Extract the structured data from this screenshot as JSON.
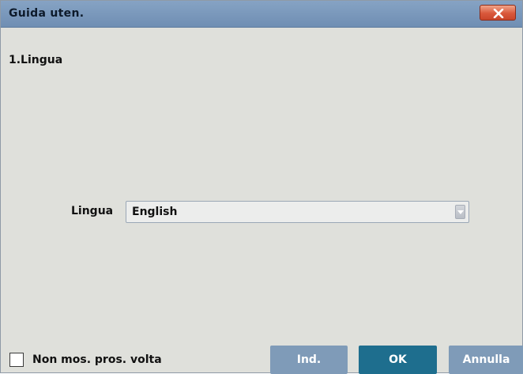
{
  "window": {
    "title": "Guida uten.",
    "close_icon": "close-icon"
  },
  "step": {
    "heading": "1.Lingua"
  },
  "language": {
    "label": "Lingua",
    "selected": "English",
    "dropdown_icon": "chevron-down-icon"
  },
  "footer": {
    "dont_show_label": "Non mos. pros. volta",
    "dont_show_checked": false,
    "buttons": {
      "index": "Ind.",
      "ok": "OK",
      "cancel": "Annulla"
    }
  },
  "colors": {
    "titlebar": "#7b99bd",
    "dialog_bg": "#dfe0db",
    "close_button": "#d9583b",
    "primary_button": "#1e6e8e",
    "secondary_button": "#7f9bb8"
  }
}
